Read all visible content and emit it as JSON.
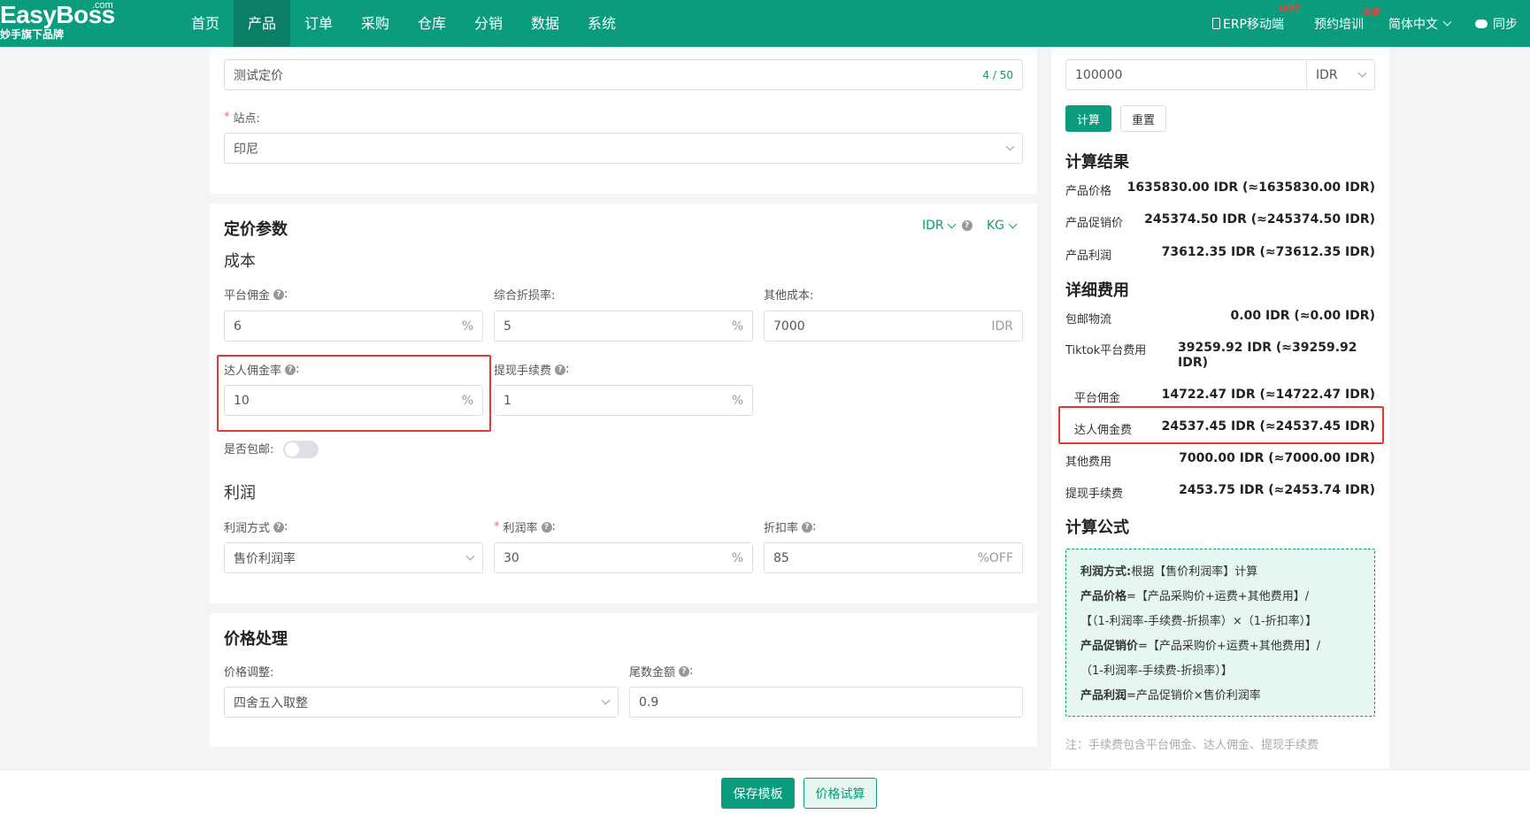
{
  "brand": {
    "logo": "EasyBoss",
    "com": ".com",
    "subtitle": "妙手旗下品牌"
  },
  "nav": {
    "items": [
      "首页",
      "产品",
      "订单",
      "采购",
      "仓库",
      "分销",
      "数据",
      "系统"
    ]
  },
  "nav_right": {
    "erp": "ERP移动端",
    "erp_tag": "HOT",
    "training": "预约培训",
    "training_tag": "免费",
    "language": "简体中文",
    "sync": "同步"
  },
  "basic": {
    "name_value": "测试定价",
    "name_counter": "4 / 50",
    "site_label": "站点:",
    "site_value": "印尼"
  },
  "pricing": {
    "title": "定价参数",
    "currency": "IDR",
    "weight_unit": "KG",
    "cost_title": "成本",
    "platform_fee_label": "平台佣金",
    "platform_fee_value": "6",
    "platform_fee_unit": "%",
    "loss_label": "综合折损率:",
    "loss_value": "5",
    "loss_unit": "%",
    "other_cost_label": "其他成本:",
    "other_cost_value": "7000",
    "other_cost_unit": "IDR",
    "influencer_label": "达人佣金率",
    "influencer_value": "10",
    "influencer_unit": "%",
    "withdraw_label": "提现手续费",
    "withdraw_value": "1",
    "withdraw_unit": "%",
    "free_ship_label": "是否包邮:",
    "profit_title": "利润",
    "profit_mode_label": "利润方式",
    "profit_mode_value": "售价利润率",
    "profit_rate_label": "利润率",
    "profit_rate_value": "30",
    "profit_rate_unit": "%",
    "discount_label": "折扣率",
    "discount_value": "85",
    "discount_unit": "%OFF"
  },
  "price_handling": {
    "title": "价格处理",
    "adjust_label": "价格调整:",
    "adjust_value": "四舍五入取整",
    "tail_label": "尾数金额",
    "tail_value": "0.9"
  },
  "calculator": {
    "input_value": "100000",
    "currency": "IDR",
    "calc_btn": "计算",
    "reset_btn": "重置",
    "result_title": "计算结果",
    "results": [
      {
        "label": "产品价格",
        "value": "1635830.00 IDR (≈1635830.00 IDR)"
      },
      {
        "label": "产品促销价",
        "value": "245374.50 IDR (≈245374.50 IDR)"
      },
      {
        "label": "产品利润",
        "value": "73612.35 IDR (≈73612.35 IDR)"
      }
    ],
    "detail_title": "详细费用",
    "details": [
      {
        "label": "包邮物流",
        "value": "0.00 IDR (≈0.00 IDR)"
      },
      {
        "label": "Tiktok平台费用",
        "value_line1": "39259.92 IDR (≈39259.92",
        "value_line2": "IDR)"
      },
      {
        "label": "平台佣金",
        "value": "14722.47 IDR (≈14722.47 IDR)"
      },
      {
        "label": "达人佣金费",
        "value": "24537.45 IDR (≈24537.45 IDR)"
      },
      {
        "label": "其他费用",
        "value": "7000.00 IDR (≈7000.00 IDR)"
      },
      {
        "label": "提现手续费",
        "value": "2453.75 IDR (≈2453.74 IDR)"
      }
    ],
    "formula_title": "计算公式",
    "formula": {
      "l1_b": "利润方式:",
      "l1": "根据【售价利润率】计算",
      "l2_b": "产品价格",
      "l2": "=【产品采购价+运费+其他费用】/",
      "l3": "【（1-利润率-手续费-折损率）×（1-折扣率）】",
      "l4_b": "产品促销价",
      "l4": "=【产品采购价+运费+其他费用】/",
      "l5": "（1-利润率-手续费-折损率）】",
      "l6_b": "产品利润",
      "l6": "=产品促销价×售价利润率"
    },
    "note": "注：手续费包含平台佣金、达人佣金、提现手续费"
  },
  "footer": {
    "save": "保存模板",
    "trial": "价格试算"
  },
  "colors": {
    "primary": "#0b9b7d",
    "highlight": "#e53935"
  }
}
